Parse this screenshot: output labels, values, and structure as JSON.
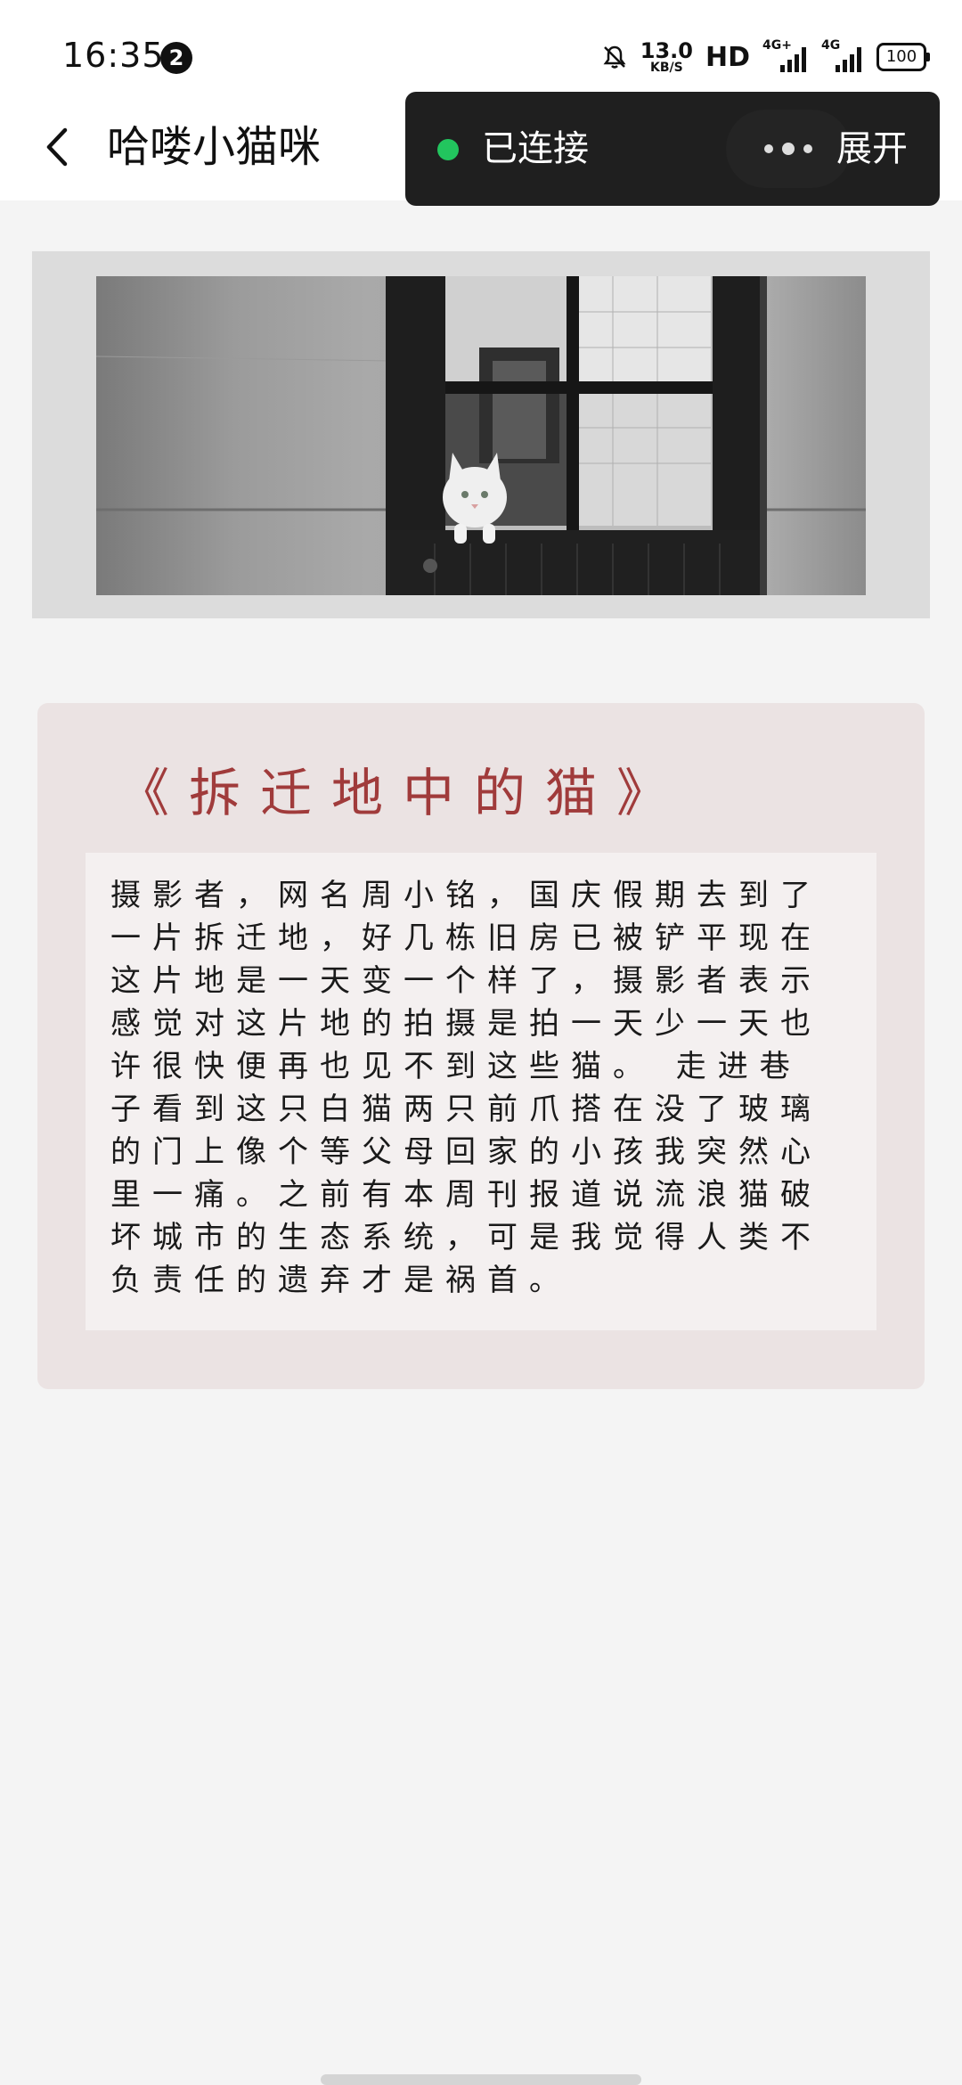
{
  "status_bar": {
    "time": "16:35",
    "notification_count": "2",
    "net_speed_value": "13.0",
    "net_speed_unit": "KB/S",
    "hd_label": "HD",
    "signal_1_label": "4G+",
    "signal_2_label": "4G",
    "battery": "100"
  },
  "header": {
    "title": "哈喽小猫咪",
    "back_icon": "chevron-left-icon"
  },
  "connection": {
    "status": "已连接",
    "status_color": "#22c55e",
    "expand_label": "展开"
  },
  "banner": {
    "image": "black-and-white photo of a white cat in a doorway"
  },
  "article": {
    "title": "《拆迁地中的猫》",
    "title_color": "#a03b3b",
    "body": "摄影者，网名周小铭，国庆假期去到了一片拆迁地，好几栋旧房已被铲平现在这片地是一天变一个样了，摄影者表示感觉对这片地的拍摄是拍一天少一天也许很快便再也见不到这些猫。 走进巷子看到这只白猫两只前爪搭在没了玻璃的门上像个等父母回家的小孩我突然心里一痛。之前有本周刊报道说流浪猫破坏城市的生态系统，可是我觉得人类不负责任的遗弃才是祸首。"
  }
}
